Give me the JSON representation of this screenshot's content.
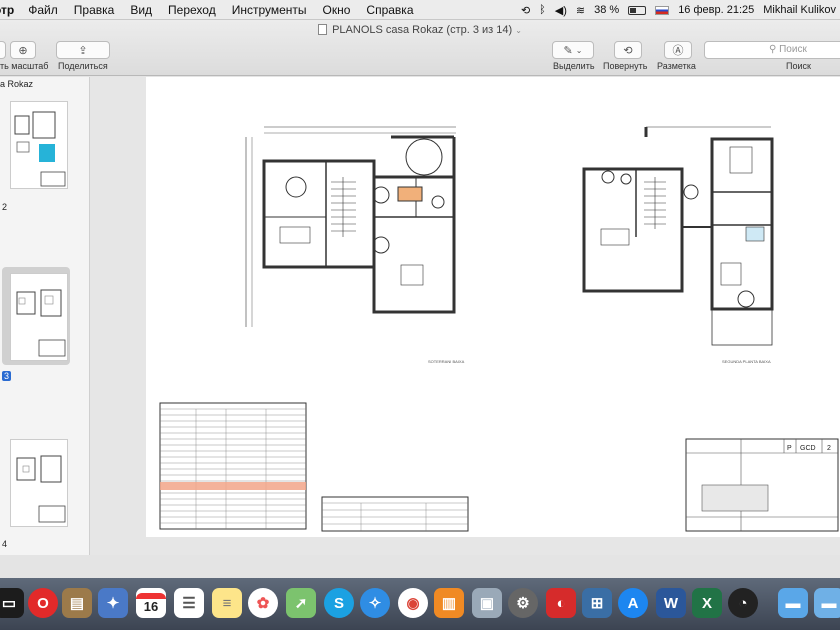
{
  "menubar": {
    "app_name": "отр",
    "menus": [
      "Файл",
      "Правка",
      "Вид",
      "Переход",
      "Инструменты",
      "Окно",
      "Справка"
    ],
    "battery": "38 %",
    "date_time": "16 февр.  21:25",
    "user": "Mikhail Kulikov"
  },
  "toolbar": {
    "doc_title": "PLANOLS casa Rokaz (стр. 3 из 14)",
    "zoom_label": "ть масштаб",
    "share_label": "Поделиться",
    "highlight_label": "Выделить",
    "rotate_label": "Повернуть",
    "markup_label": "Разметка",
    "search_placeholder": "Поиск",
    "search_label": "Поиск"
  },
  "sidebar": {
    "title": "a Rokaz",
    "pages": [
      "2",
      "3",
      "4"
    ],
    "selected_page": "3"
  },
  "drawing": {
    "left_plan_caption": "SOTERRANI BAIXA",
    "right_plan_caption": "SEGUNDA PLANTA BAIXA",
    "title_block": {
      "code_p": "P",
      "code_gcd": "GCD",
      "code_num": "2"
    }
  },
  "dock": {
    "calendar_day": "16"
  },
  "colors": {
    "selection_blue": "#2a6bd1",
    "pool_blue": "#26b3d8",
    "stair_orange": "#f1b07a",
    "table_highlight": "#f2a488"
  }
}
